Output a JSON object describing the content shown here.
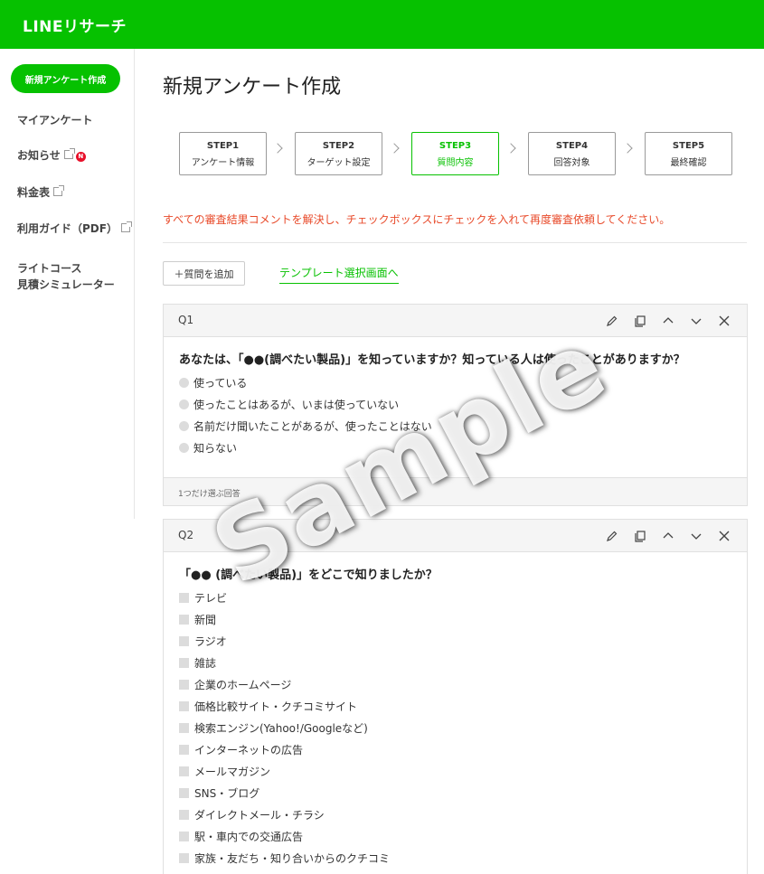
{
  "header": {
    "logo": "LINEリサーチ",
    "color": "#06c100"
  },
  "sidebar": {
    "new_button": "新規アンケート作成",
    "items": [
      {
        "label": "マイアンケート"
      },
      {
        "label": "お知らせ",
        "badge": "N"
      },
      {
        "label": "料金表"
      },
      {
        "label": "利用ガイド（PDF）"
      },
      {
        "label_line1": "ライトコース",
        "label_line2": "見積シミュレーター"
      }
    ]
  },
  "main": {
    "title": "新規アンケート作成",
    "steps": [
      {
        "num": "STEP1",
        "label": "アンケート情報"
      },
      {
        "num": "STEP2",
        "label": "ターゲット設定"
      },
      {
        "num": "STEP3",
        "label": "質問内容",
        "active": true
      },
      {
        "num": "STEP4",
        "label": "回答対象"
      },
      {
        "num": "STEP5",
        "label": "最終確認"
      }
    ],
    "warning": "すべての審査結果コメントを解決し、チェックボックスにチェックを入れて再度審査依頼してください。",
    "warning_color": "#e84a2a",
    "add_question": "＋質問を追加",
    "template_link": "テンプレート選択画面へ"
  },
  "questions": [
    {
      "num": "Q1",
      "text": "あなたは、「●●(調べたい製品)」を知っていますか？知っている人は使ったことがありますか？",
      "options": [
        "使っている",
        "使ったことはあるが、いまは使っていない",
        "名前だけ聞いたことがあるが、使ったことはない",
        "知らない"
      ],
      "footer": "1つだけ選ぶ回答"
    },
    {
      "num": "Q2",
      "text": "「●● (調べたい製品)」をどこで知りましたか？",
      "options": [
        "テレビ",
        "新聞",
        "ラジオ",
        "雑誌",
        "企業のホームページ",
        "価格比較サイト・クチコミサイト",
        "検索エンジン(Yahoo!/Googleなど)",
        "インターネットの広告",
        "メールマガジン",
        "SNS・ブログ",
        "ダイレクトメール・チラシ",
        "駅・車内での交通広告",
        "家族・友だち・知り合いからのクチコミ"
      ]
    }
  ],
  "watermark": "Sample",
  "icons": {
    "edit": "pencil-icon",
    "copy": "copy-icon",
    "up": "chevron-up-icon",
    "down": "chevron-down-icon",
    "close": "close-icon"
  }
}
